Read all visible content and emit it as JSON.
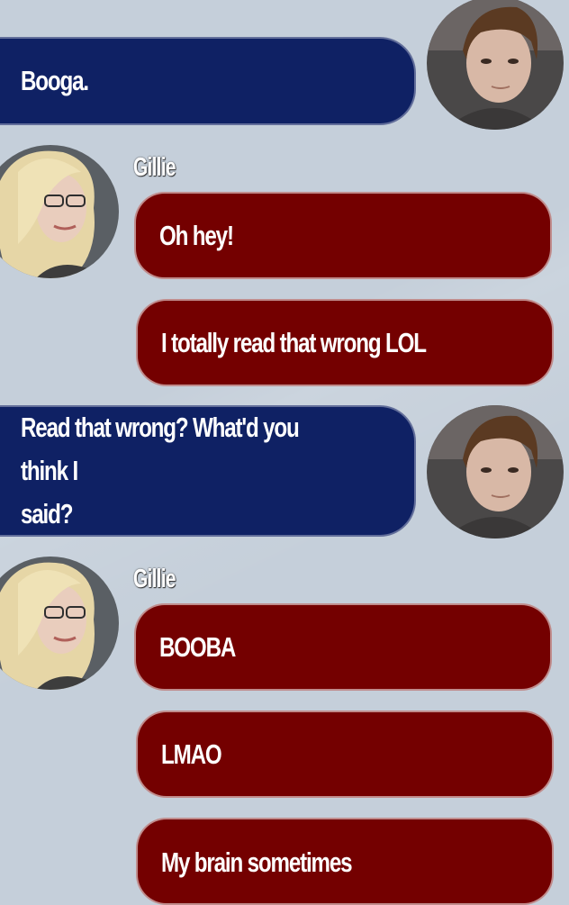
{
  "contacts": {
    "gillie": {
      "name": "Gillie"
    }
  },
  "messages": [
    {
      "sender": "self",
      "text": "Booga."
    },
    {
      "sender": "gillie",
      "text": "Oh hey!"
    },
    {
      "sender": "gillie",
      "text": "I totally read that wrong LOL"
    },
    {
      "sender": "self",
      "text": "Read that wrong? What'd you think I\nsaid?"
    },
    {
      "sender": "gillie",
      "text": "BOOBA"
    },
    {
      "sender": "gillie",
      "text": "LMAO"
    },
    {
      "sender": "gillie",
      "text": "My brain sometimes"
    }
  ],
  "colors": {
    "background": "#c5cfda",
    "self_bubble": "#0f2164",
    "contact_bubble": "#740000",
    "text": "#ffffff"
  },
  "icons": [
    "male-avatar",
    "female-avatar"
  ]
}
